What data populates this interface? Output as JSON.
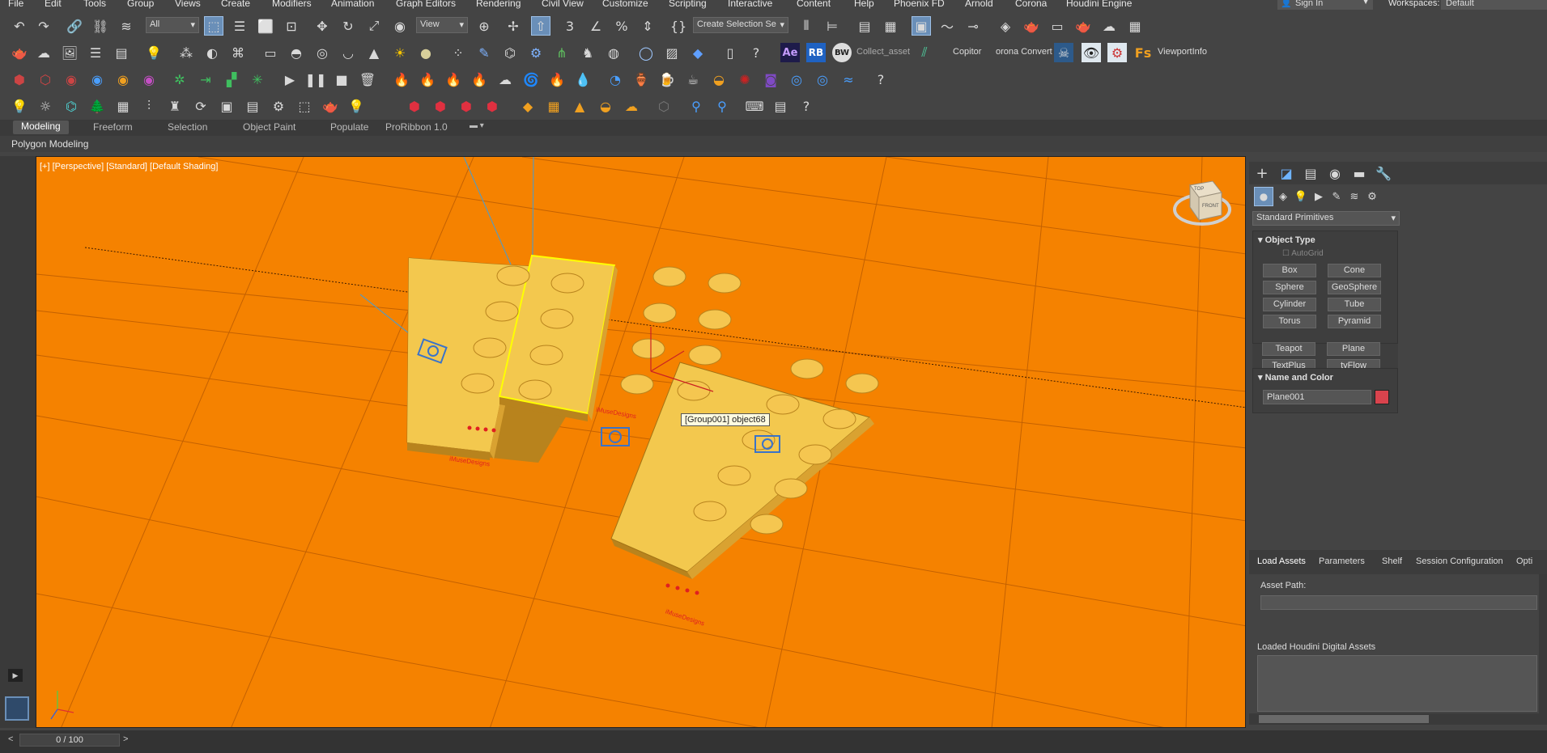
{
  "menu": [
    "File",
    "Edit",
    "Tools",
    "Group",
    "Views",
    "Create",
    "Modifiers",
    "Animation",
    "Graph Editors",
    "Rendering",
    "Civil View",
    "Customize",
    "Scripting",
    "Interactive",
    "Content",
    "Help",
    "Phoenix FD",
    "Arnold",
    "Corona",
    "Houdini Engine"
  ],
  "signin": "Sign In",
  "workspaces_label": "Workspaces:",
  "workspace_value": "Default",
  "toolbar1": {
    "filter_value": "All",
    "view_value": "View",
    "selection_set_placeholder": "Create Selection Se"
  },
  "toolbar2": {
    "collect_asset": "Collect_asset",
    "copitor": "Copitor",
    "corona_converter": "orona Convert",
    "viewport_info": "ViewportInfo",
    "ae": "Ae",
    "rb": "RB",
    "bw": "BW",
    "fs": "Fs"
  },
  "ribbon": {
    "tabs": [
      "Modeling",
      "Freeform",
      "Selection",
      "Object Paint",
      "Populate",
      "ProRibbon 1.0"
    ],
    "active_tab": "Modeling",
    "sub_label": "Polygon Modeling"
  },
  "viewport": {
    "label": "[+] [Perspective] [Standard] [Default Shading]",
    "tooltip": "[Group001] object68",
    "background": "#f58200",
    "device_brand": "iMuseDesigns",
    "viewcube_top": "TOP",
    "viewcube_front": "FRONT"
  },
  "command_panel": {
    "category": "Standard Primitives",
    "object_type_title": "Object Type",
    "autogrid": "AutoGrid",
    "buttons": [
      "Box",
      "Cone",
      "Sphere",
      "GeoSphere",
      "Cylinder",
      "Tube",
      "Torus",
      "Pyramid",
      "Teapot",
      "Plane",
      "TextPlus",
      "tyFlow"
    ],
    "name_color_title": "Name and Color",
    "object_name": "Plane001",
    "object_color": "#d9434d"
  },
  "houdini": {
    "tabs": [
      "Load Assets",
      "Parameters",
      "Shelf",
      "Session Configuration",
      "Opti"
    ],
    "asset_path_label": "Asset Path:",
    "loaded_label": "Loaded Houdini Digital Assets"
  },
  "timeline": {
    "frame": "0 / 100"
  }
}
